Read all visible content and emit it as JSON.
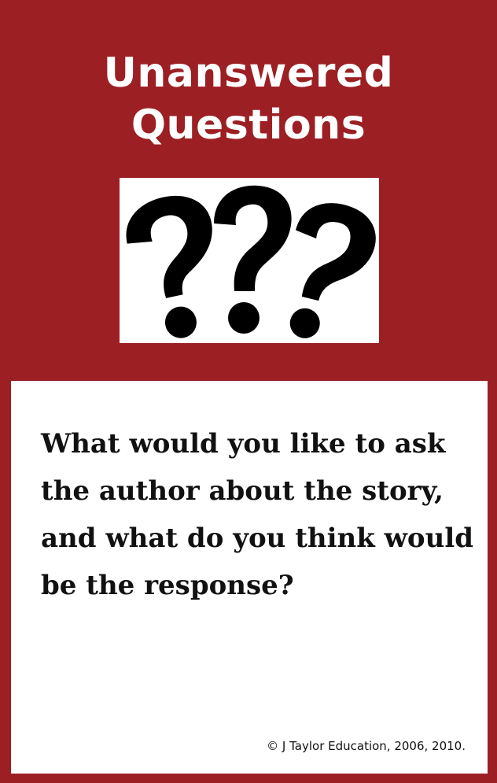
{
  "card": {
    "title_line1": "Unanswered",
    "title_line2": "Questions",
    "prompt": "What would you like to ask the author about the story, and what do you think would be the response?",
    "copyright": "© J Taylor Education, 2006, 2010.",
    "illustration_icon": "three-question-marks-icon"
  },
  "colors": {
    "background": "#9c1f24",
    "panel": "#ffffff",
    "text": "#111111",
    "title": "#ffffff"
  }
}
